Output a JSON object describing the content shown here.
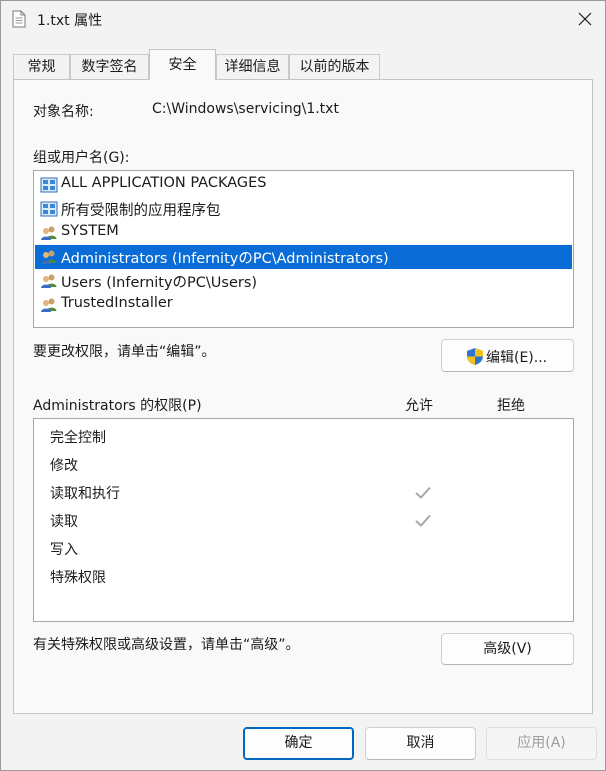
{
  "window": {
    "title": "1.txt 属性",
    "icon": "text-file-icon",
    "close_icon": "close-icon"
  },
  "tabs": [
    {
      "label": "常规",
      "active": false
    },
    {
      "label": "数字签名",
      "active": false
    },
    {
      "label": "安全",
      "active": true
    },
    {
      "label": "详细信息",
      "active": false
    },
    {
      "label": "以前的版本",
      "active": false
    }
  ],
  "security": {
    "object_name_label": "对象名称:",
    "object_name_value": "C:\\Windows\\servicing\\1.txt",
    "groups_label": "组或用户名(G):",
    "groups": [
      {
        "name": "ALL APPLICATION PACKAGES",
        "icon": "app-package-icon",
        "selected": false
      },
      {
        "name": "所有受限制的应用程序包",
        "icon": "app-package-icon",
        "selected": false
      },
      {
        "name": "SYSTEM",
        "icon": "user-group-icon",
        "selected": false
      },
      {
        "name": "Administrators (InfernityのPC\\Administrators)",
        "icon": "user-group-icon",
        "selected": true
      },
      {
        "name": "Users (InfernityのPC\\Users)",
        "icon": "user-group-icon",
        "selected": false
      },
      {
        "name": "TrustedInstaller",
        "icon": "user-group-icon",
        "selected": false
      }
    ],
    "change_hint": "要更改权限，请单击“编辑”。",
    "edit_button": "编辑(E)...",
    "edit_icon": "uac-shield-icon",
    "permissions_label": "Administrators 的权限(P)",
    "allow_header": "允许",
    "deny_header": "拒绝",
    "permissions": [
      {
        "name": "完全控制",
        "allow": false,
        "deny": false
      },
      {
        "name": "修改",
        "allow": false,
        "deny": false
      },
      {
        "name": "读取和执行",
        "allow": true,
        "deny": false
      },
      {
        "name": "读取",
        "allow": true,
        "deny": false
      },
      {
        "name": "写入",
        "allow": false,
        "deny": false
      },
      {
        "name": "特殊权限",
        "allow": false,
        "deny": false
      }
    ],
    "advanced_hint": "有关特殊权限或高级设置，请单击“高级”。",
    "advanced_button": "高级(V)"
  },
  "footer": {
    "ok": "确定",
    "cancel": "取消",
    "apply": "应用(A)"
  },
  "colors": {
    "selection": "#0a6cd6",
    "accent": "#0067c0",
    "check": "#a6a6a6"
  }
}
